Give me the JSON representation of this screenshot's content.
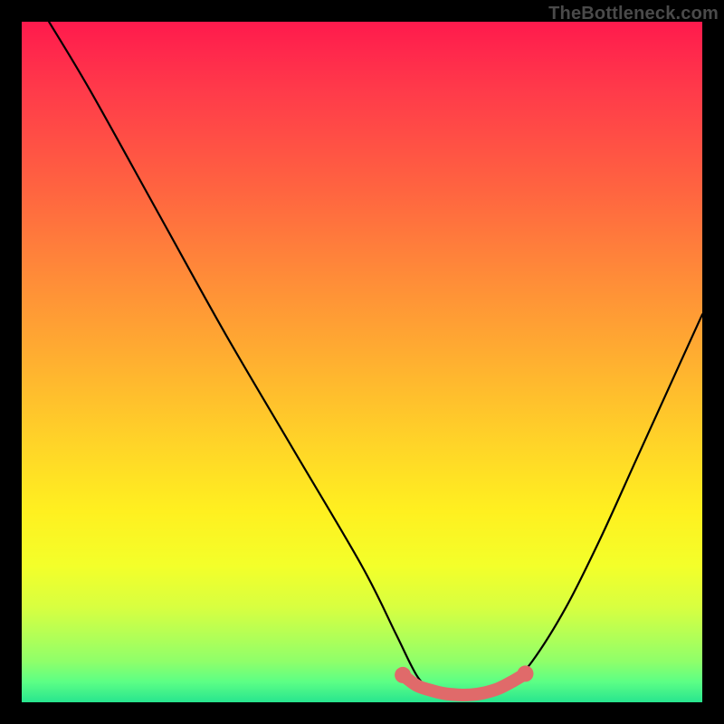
{
  "watermark": "TheBottleneck.com",
  "colors": {
    "background": "#000000",
    "curve": "#000000",
    "highlight": "#e06a6a",
    "gradient_stops": [
      "#ff1a4d",
      "#ff3a4a",
      "#ff6540",
      "#ff8d38",
      "#ffb030",
      "#ffd428",
      "#fff020",
      "#f3ff2a",
      "#d8ff40",
      "#b5ff55",
      "#8fff6a",
      "#5cff85",
      "#28e58f"
    ]
  },
  "chart_data": {
    "type": "line",
    "title": "",
    "xlabel": "",
    "ylabel": "",
    "xlim": [
      0,
      100
    ],
    "ylim": [
      0,
      100
    ],
    "grid": false,
    "series": [
      {
        "name": "bottleneck-curve",
        "x": [
          4,
          10,
          20,
          30,
          40,
          50,
          55,
          58,
          60,
          62,
          65,
          68,
          70,
          72,
          75,
          80,
          85,
          90,
          95,
          100
        ],
        "y": [
          100,
          90,
          72,
          54,
          37,
          20,
          10,
          4,
          2,
          1,
          1,
          1,
          2,
          3,
          6,
          14,
          24,
          35,
          46,
          57
        ]
      },
      {
        "name": "bottom-highlight",
        "x": [
          56,
          58,
          60,
          62,
          64,
          66,
          68,
          70,
          72,
          74
        ],
        "y": [
          4,
          2.5,
          1.8,
          1.3,
          1.1,
          1.1,
          1.4,
          2,
          3,
          4.2
        ]
      }
    ],
    "annotations": []
  }
}
